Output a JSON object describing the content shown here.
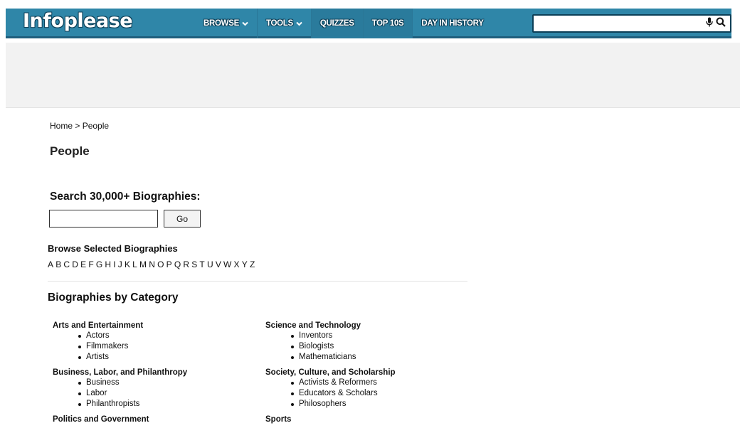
{
  "header": {
    "logo": "Infoplease",
    "nav": [
      {
        "label": "BROWSE",
        "dropdown": true
      },
      {
        "label": "TOOLS",
        "dropdown": true
      },
      {
        "label": "QUIZZES",
        "dropdown": false
      },
      {
        "label": "TOP 10S",
        "dropdown": false
      },
      {
        "label": "DAY IN HISTORY",
        "dropdown": false
      }
    ],
    "search": {
      "value": "",
      "placeholder": ""
    }
  },
  "breadcrumb": {
    "home": "Home",
    "separator": " > ",
    "current": "People"
  },
  "page_title": "People",
  "bio_search": {
    "label": "Search 30,000+ Biographies:",
    "value": "",
    "go_label": "Go"
  },
  "browse": {
    "label": "Browse Selected Biographies",
    "letters": [
      "A",
      "B",
      "C",
      "D",
      "E",
      "F",
      "G",
      "H",
      "I",
      "J",
      "K",
      "L",
      "M",
      "N",
      "O",
      "P",
      "Q",
      "R",
      "S",
      "T",
      "U",
      "V",
      "W",
      "X",
      "Y",
      "Z"
    ]
  },
  "categories": {
    "heading": "Biographies by Category",
    "left": [
      {
        "title": "Arts and Entertainment",
        "items": [
          "Actors",
          "Filmmakers",
          "Artists"
        ]
      },
      {
        "title": "Business, Labor, and Philanthropy",
        "items": [
          "Business",
          "Labor",
          "Philanthropists"
        ]
      },
      {
        "title": "Politics and Government",
        "items": []
      }
    ],
    "right": [
      {
        "title": "Science and Technology",
        "items": [
          "Inventors",
          "Biologists",
          "Mathematicians"
        ]
      },
      {
        "title": "Society, Culture, and Scholarship",
        "items": [
          "Activists & Reformers",
          "Educators & Scholars",
          "Philosophers"
        ]
      },
      {
        "title": "Sports",
        "items": []
      }
    ]
  },
  "colors": {
    "header_bg": "#2f86a8",
    "header_border": "#1f5f7d",
    "ad_bg": "#f2f2f2"
  },
  "icons": {
    "dropdown": "chevron-down-icon",
    "voice": "microphone-icon",
    "search": "search-icon"
  }
}
